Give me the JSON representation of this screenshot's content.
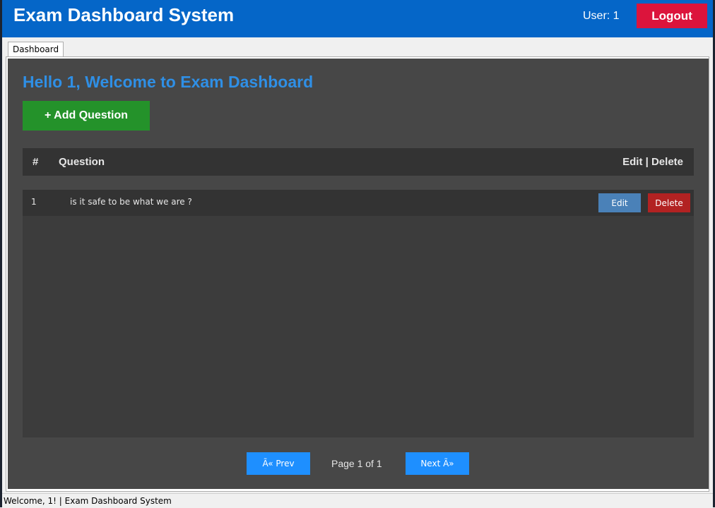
{
  "header": {
    "title": "Exam Dashboard System",
    "user_label": "User: 1",
    "logout_label": "Logout"
  },
  "tabs": [
    {
      "label": "Dashboard"
    }
  ],
  "dashboard": {
    "welcome": "Hello 1, Welcome to Exam Dashboard",
    "add_question_label": "+ Add Question",
    "table": {
      "columns": [
        "#",
        "Question",
        "Edit | Delete"
      ],
      "rows": [
        {
          "num": "1",
          "question": "is it safe to be what we are ?",
          "edit_label": "Edit",
          "delete_label": "Delete"
        }
      ]
    },
    "pagination": {
      "prev_label": "Ã« Prev",
      "page_label": "Page 1 of 1",
      "next_label": "Next Ã»"
    }
  },
  "statusbar": {
    "text": "Welcome, 1! | Exam Dashboard System"
  },
  "colors": {
    "header": "#0566c8",
    "logout": "#dc143c",
    "add": "#24922a",
    "edit": "#4a81b8",
    "delete": "#b22222",
    "pager": "#1e8fff",
    "welcome": "#2f8fe5"
  }
}
